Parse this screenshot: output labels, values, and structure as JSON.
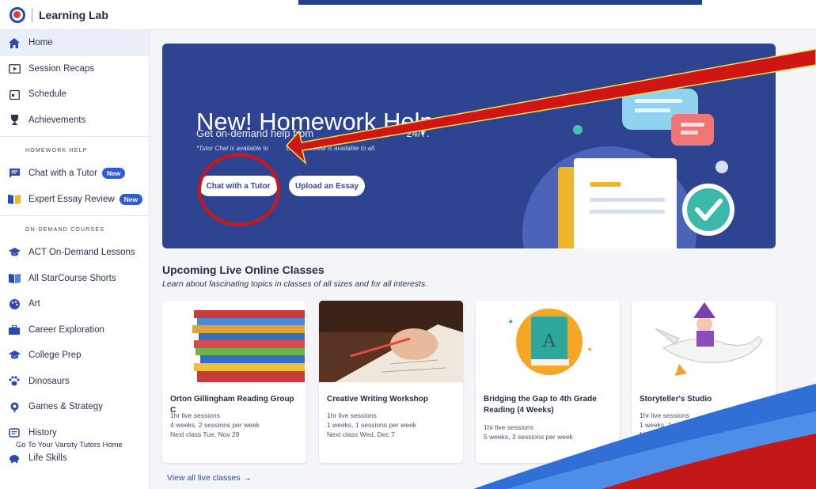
{
  "app": {
    "title": "Learning Lab"
  },
  "sidebar": {
    "items_top": [
      {
        "label": "Home",
        "icon": "home-icon",
        "active": true
      },
      {
        "label": "Session Recaps",
        "icon": "play-icon"
      },
      {
        "label": "Schedule",
        "icon": "calendar-icon"
      },
      {
        "label": "Achievements",
        "icon": "trophy-icon"
      }
    ],
    "homework_head": "HOMEWORK HELP",
    "homework_items": [
      {
        "label": "Chat with a Tutor",
        "icon": "chat-icon",
        "badge": "New"
      },
      {
        "label": "Expert Essay Review",
        "icon": "book-icon",
        "badge": "New"
      }
    ],
    "courses_head": "ON-DEMAND COURSES",
    "course_items": [
      {
        "label": "ACT On-Demand Lessons",
        "icon": "graduation-cap-icon"
      },
      {
        "label": "All StarCourse Shorts",
        "icon": "book-open-icon"
      },
      {
        "label": "Art",
        "icon": "palette-icon"
      },
      {
        "label": "Career Exploration",
        "icon": "briefcase-icon"
      },
      {
        "label": "College Prep",
        "icon": "graduation-cap-icon"
      },
      {
        "label": "Dinosaurs",
        "icon": "paw-icon"
      },
      {
        "label": "Games & Strategy",
        "icon": "game-icon"
      },
      {
        "label": "History",
        "icon": "scroll-icon"
      },
      {
        "label": "Life Skills",
        "icon": "piggy-bank-icon"
      }
    ],
    "footer": "Go To Your Varsity Tutors Home"
  },
  "hero": {
    "title": "New! Homework Help",
    "subtitle_a": "Get on-demand help from",
    "subtitle_b": "24/7.",
    "note_a": "*Tutor Chat is available to",
    "note_b": "Essay Review is available to all.",
    "chat_button": "Chat with a Tutor",
    "essay_button": "Upload an Essay"
  },
  "live": {
    "title": "Upcoming Live Online Classes",
    "subtitle": "Learn about fascinating topics in classes of all sizes and for all interests.",
    "view_all": "View all live classes",
    "cards": [
      {
        "title": "Orton Gillingham Reading Group C",
        "line1": "1hr live sessions",
        "line2": "4 weeks, 2 sessions per week",
        "line3": "Next class Tue, Nov 29"
      },
      {
        "title": "Creative Writing Workshop",
        "line1": "1hr live sessions",
        "line2": "1 weeks, 1 sessions per week",
        "line3": "Next class Wed, Dec 7"
      },
      {
        "title": "Bridging the Gap to 4th Grade Reading (4 Weeks)",
        "line1": "1hr live sessions",
        "line2": "5 weeks, 3 sessions per week",
        "line3": ""
      },
      {
        "title": "Storyteller's Studio",
        "line1": "1hr live sessions",
        "line2": "1 weeks, 1 sessions per w",
        "line3": "Next class W"
      }
    ]
  },
  "colors": {
    "brand": "#2f4491",
    "accent": "#2e5bd8",
    "annotation": "#d01515"
  }
}
